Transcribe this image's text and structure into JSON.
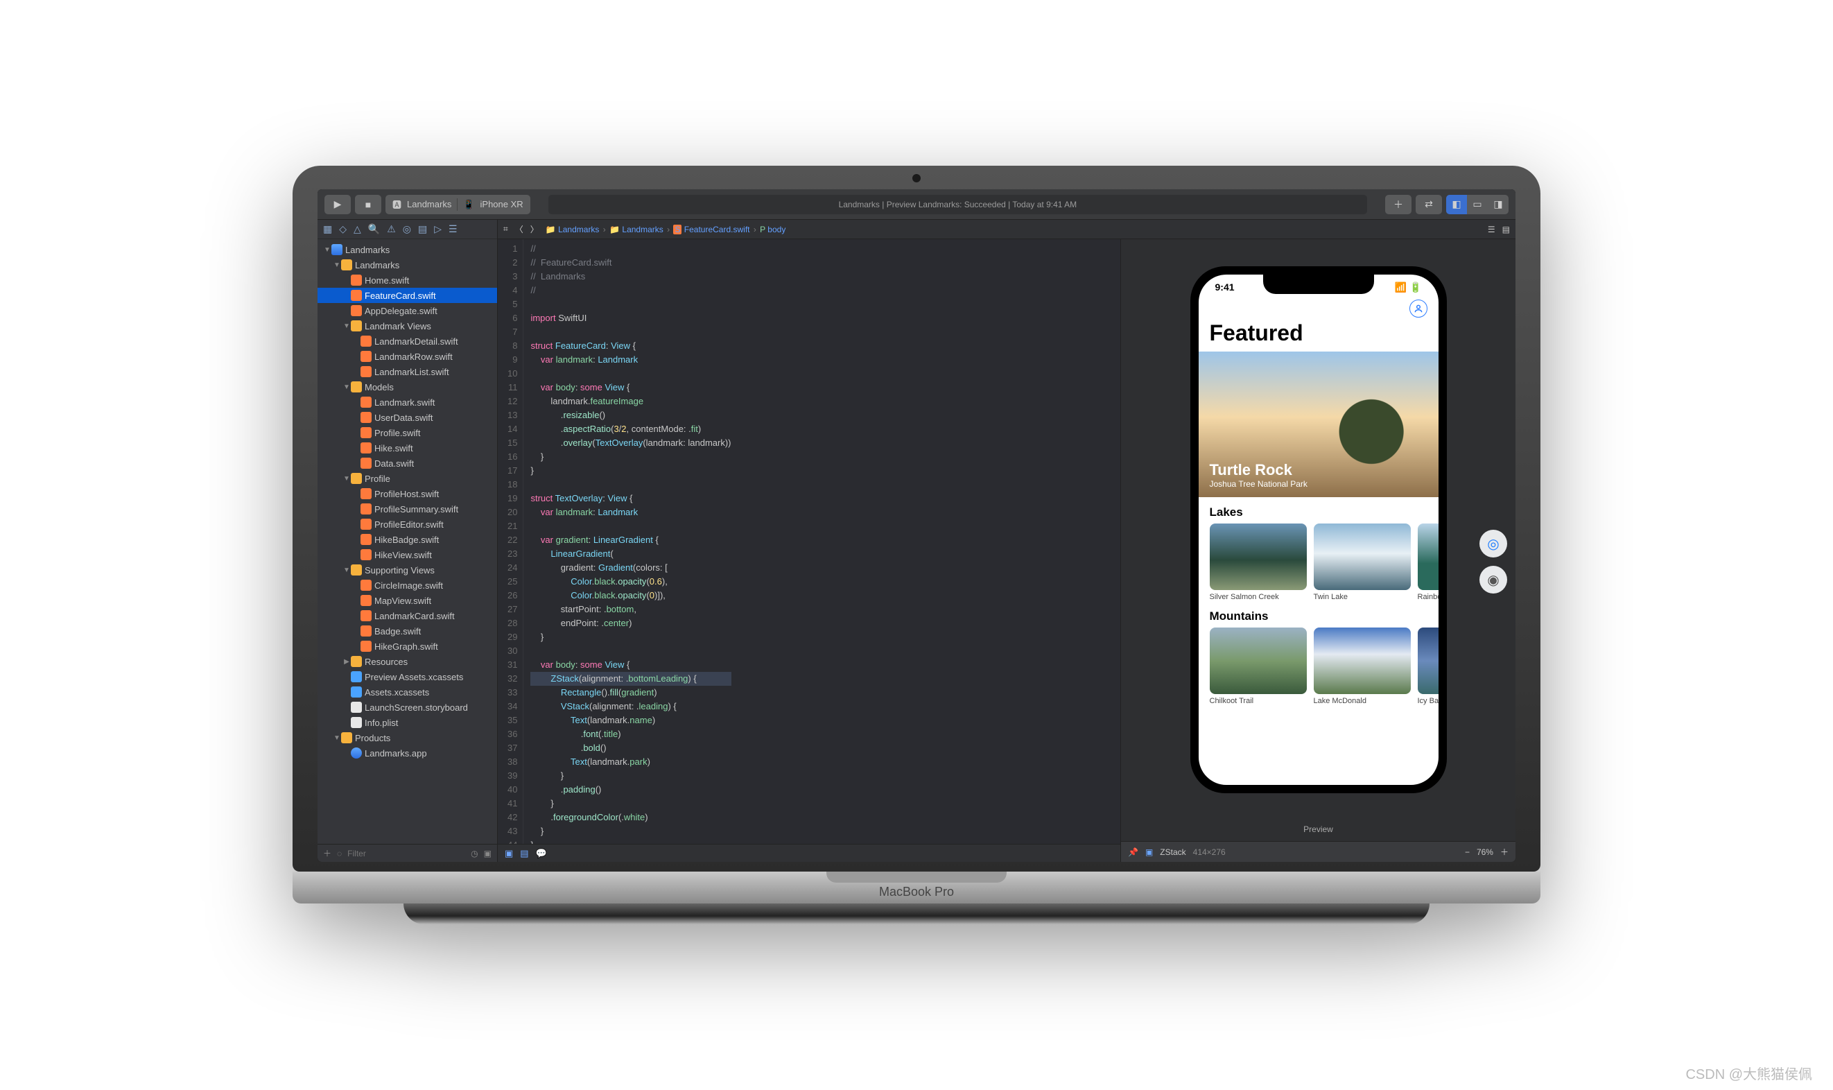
{
  "toolbar": {
    "scheme_app": "Landmarks",
    "scheme_device": "iPhone XR",
    "activity": "Landmarks | Preview Landmarks: Succeeded | Today at 9:41 AM"
  },
  "nav_filter_placeholder": "Filter",
  "tree": [
    {
      "d": 0,
      "t": "proj",
      "e": true,
      "l": "Landmarks"
    },
    {
      "d": 1,
      "t": "folder",
      "e": true,
      "l": "Landmarks"
    },
    {
      "d": 2,
      "t": "swift",
      "l": "Home.swift"
    },
    {
      "d": 2,
      "t": "swift",
      "l": "FeatureCard.swift",
      "sel": true
    },
    {
      "d": 2,
      "t": "swift",
      "l": "AppDelegate.swift"
    },
    {
      "d": 2,
      "t": "folder",
      "e": true,
      "l": "Landmark Views"
    },
    {
      "d": 3,
      "t": "swift",
      "l": "LandmarkDetail.swift"
    },
    {
      "d": 3,
      "t": "swift",
      "l": "LandmarkRow.swift"
    },
    {
      "d": 3,
      "t": "swift",
      "l": "LandmarkList.swift"
    },
    {
      "d": 2,
      "t": "folder",
      "e": true,
      "l": "Models"
    },
    {
      "d": 3,
      "t": "swift",
      "l": "Landmark.swift"
    },
    {
      "d": 3,
      "t": "swift",
      "l": "UserData.swift"
    },
    {
      "d": 3,
      "t": "swift",
      "l": "Profile.swift"
    },
    {
      "d": 3,
      "t": "swift",
      "l": "Hike.swift"
    },
    {
      "d": 3,
      "t": "swift",
      "l": "Data.swift"
    },
    {
      "d": 2,
      "t": "folder",
      "e": true,
      "l": "Profile"
    },
    {
      "d": 3,
      "t": "swift",
      "l": "ProfileHost.swift"
    },
    {
      "d": 3,
      "t": "swift",
      "l": "ProfileSummary.swift"
    },
    {
      "d": 3,
      "t": "swift",
      "l": "ProfileEditor.swift"
    },
    {
      "d": 3,
      "t": "swift",
      "l": "HikeBadge.swift"
    },
    {
      "d": 3,
      "t": "swift",
      "l": "HikeView.swift"
    },
    {
      "d": 2,
      "t": "folder",
      "e": true,
      "l": "Supporting Views"
    },
    {
      "d": 3,
      "t": "swift",
      "l": "CircleImage.swift"
    },
    {
      "d": 3,
      "t": "swift",
      "l": "MapView.swift"
    },
    {
      "d": 3,
      "t": "swift",
      "l": "LandmarkCard.swift"
    },
    {
      "d": 3,
      "t": "swift",
      "l": "Badge.swift"
    },
    {
      "d": 3,
      "t": "swift",
      "l": "HikeGraph.swift"
    },
    {
      "d": 2,
      "t": "folder",
      "e": false,
      "l": "Resources"
    },
    {
      "d": 2,
      "t": "asset",
      "l": "Preview Assets.xcassets"
    },
    {
      "d": 2,
      "t": "asset",
      "l": "Assets.xcassets"
    },
    {
      "d": 2,
      "t": "sb",
      "l": "LaunchScreen.storyboard"
    },
    {
      "d": 2,
      "t": "plist",
      "l": "Info.plist"
    },
    {
      "d": 1,
      "t": "folder",
      "e": true,
      "l": "Products"
    },
    {
      "d": 2,
      "t": "app",
      "l": "Landmarks.app"
    }
  ],
  "breadcrumb": [
    "Landmarks",
    "Landmarks",
    "FeatureCard.swift",
    "body"
  ],
  "code": [
    {
      "c": "//",
      "cls": "k-com"
    },
    {
      "c": "//  FeatureCard.swift",
      "cls": "k-com"
    },
    {
      "c": "//  Landmarks",
      "cls": "k-com"
    },
    {
      "c": "//",
      "cls": "k-com"
    },
    {
      "c": ""
    },
    {
      "h": "<span class='k-key'>import</span> SwiftUI"
    },
    {
      "c": ""
    },
    {
      "h": "<span class='k-key'>struct</span> <span class='k-type'>FeatureCard</span>: <span class='k-type'>View</span> {"
    },
    {
      "h": "    <span class='k-key'>var</span> <span class='k-prop'>landmark</span>: <span class='k-type'>Landmark</span>"
    },
    {
      "c": ""
    },
    {
      "h": "    <span class='k-key'>var</span> <span class='k-prop'>body</span>: <span class='k-key'>some</span> <span class='k-type'>View</span> {"
    },
    {
      "h": "        landmark.<span class='k-prop'>featureImage</span>"
    },
    {
      "h": "            .<span class='k-func'>resizable</span>()"
    },
    {
      "h": "            .<span class='k-func'>aspectRatio</span>(<span class='k-num'>3</span>/<span class='k-num'>2</span>, contentMode: .<span class='k-prop'>fit</span>)"
    },
    {
      "h": "            .<span class='k-func'>overlay</span>(<span class='k-type'>TextOverlay</span>(landmark: landmark))"
    },
    {
      "c": "    }"
    },
    {
      "c": "}"
    },
    {
      "c": ""
    },
    {
      "h": "<span class='k-key'>struct</span> <span class='k-type'>TextOverlay</span>: <span class='k-type'>View</span> {"
    },
    {
      "h": "    <span class='k-key'>var</span> <span class='k-prop'>landmark</span>: <span class='k-type'>Landmark</span>"
    },
    {
      "c": ""
    },
    {
      "h": "    <span class='k-key'>var</span> <span class='k-prop'>gradient</span>: <span class='k-type'>LinearGradient</span> {"
    },
    {
      "h": "        <span class='k-type'>LinearGradient</span>("
    },
    {
      "h": "            gradient: <span class='k-type'>Gradient</span>(colors: ["
    },
    {
      "h": "                <span class='k-type'>Color</span>.<span class='k-prop'>black</span>.<span class='k-func'>opacity</span>(<span class='k-num'>0.6</span>),"
    },
    {
      "h": "                <span class='k-type'>Color</span>.<span class='k-prop'>black</span>.<span class='k-func'>opacity</span>(<span class='k-num'>0</span>)]),"
    },
    {
      "h": "            startPoint: .<span class='k-prop'>bottom</span>,"
    },
    {
      "h": "            endPoint: .<span class='k-prop'>center</span>)"
    },
    {
      "c": "    }"
    },
    {
      "c": ""
    },
    {
      "h": "    <span class='k-key'>var</span> <span class='k-prop'>body</span>: <span class='k-key'>some</span> <span class='k-type'>View</span> {"
    },
    {
      "h": "        <span class='k-type'>ZStack</span>(alignment: .<span class='k-prop'>bottomLeading</span>) {",
      "hl": true
    },
    {
      "h": "            <span class='k-type'>Rectangle</span>().<span class='k-func'>fill</span>(<span class='k-prop'>gradient</span>)"
    },
    {
      "h": "            <span class='k-type'>VStack</span>(alignment: .<span class='k-prop'>leading</span>) {"
    },
    {
      "h": "                <span class='k-type'>Text</span>(landmark.<span class='k-prop'>name</span>)"
    },
    {
      "h": "                    .<span class='k-func'>font</span>(.<span class='k-prop'>title</span>)"
    },
    {
      "h": "                    .<span class='k-func'>bold</span>()"
    },
    {
      "h": "                <span class='k-type'>Text</span>(landmark.<span class='k-prop'>park</span>)"
    },
    {
      "c": "            }"
    },
    {
      "h": "            .<span class='k-func'>padding</span>()"
    },
    {
      "c": "        }"
    },
    {
      "h": "        .<span class='k-func'>foregroundColor</span>(.<span class='k-prop'>white</span>)"
    },
    {
      "c": "    }"
    },
    {
      "c": "}"
    }
  ],
  "preview": {
    "time": "9:41",
    "title": "Featured",
    "hero_title": "Turtle Rock",
    "hero_sub": "Joshua Tree National Park",
    "sections": [
      {
        "title": "Lakes",
        "items": [
          {
            "l": "Silver Salmon Creek",
            "g": "g-lake1"
          },
          {
            "l": "Twin Lake",
            "g": "g-lake2"
          },
          {
            "l": "Rainbow L",
            "g": "g-lake3"
          }
        ]
      },
      {
        "title": "Mountains",
        "items": [
          {
            "l": "Chilkoot Trail",
            "g": "g-m1"
          },
          {
            "l": "Lake McDonald",
            "g": "g-m2"
          },
          {
            "l": "Icy Bay",
            "g": "g-m3"
          }
        ]
      }
    ],
    "label": "Preview",
    "footer_view": "ZStack",
    "footer_dim": "414×276",
    "zoom": "76%"
  },
  "macbook_label": "MacBook Pro",
  "watermark": "CSDN @大熊猫侯佩"
}
